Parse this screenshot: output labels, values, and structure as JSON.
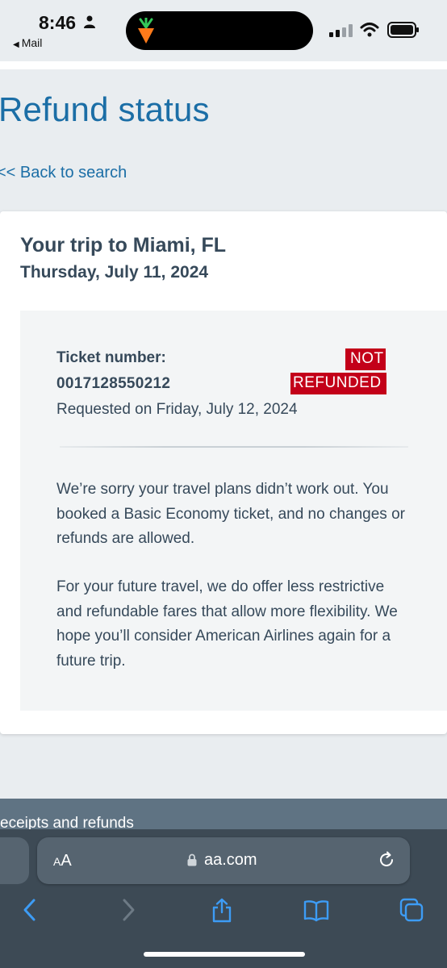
{
  "status_bar": {
    "time": "8:46",
    "back_app": "Mail"
  },
  "page": {
    "title": "Refund status",
    "back_link": "<< Back to search"
  },
  "trip": {
    "title": "Your trip to Miami, FL",
    "date": "Thursday, July 11, 2024"
  },
  "ticket": {
    "label": "Ticket number:",
    "number": "0017128550212",
    "requested": "Requested on Friday, July 12, 2024",
    "status_line1": "NOT",
    "status_line2": "REFUNDED",
    "status_color": "#c30019"
  },
  "message": {
    "paragraph1": "We’re sorry your travel plans didn’t work out. You booked a Basic Economy ticket, and no changes or refunds are allowed.",
    "paragraph2": "For your future travel, we do offer less restrictive and refundable fares that allow more flexibility. We hope you’ll consider American Airlines again for a future trip."
  },
  "footer": {
    "partial_text": "eceipts and refunds"
  },
  "browser": {
    "aa_small": "A",
    "aa_large": "A",
    "domain": "aa.com",
    "icons": [
      "back-icon",
      "forward-icon",
      "share-icon",
      "bookmarks-icon",
      "tabs-icon"
    ]
  },
  "colors": {
    "brand_blue": "#1b6ea6",
    "text": "#36495a",
    "alert_red": "#c30019"
  }
}
